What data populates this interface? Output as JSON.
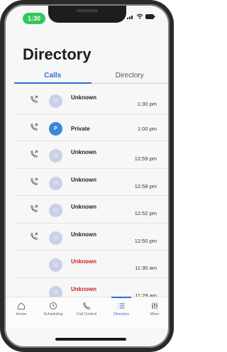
{
  "status_bar": {
    "time": "1:30"
  },
  "header": {
    "title": "Directory"
  },
  "tabs": [
    {
      "label": "Calls",
      "active": true
    },
    {
      "label": "Directory",
      "active": false
    }
  ],
  "calls": [
    {
      "avatar": "U",
      "name": "Unknown",
      "time": "1:30 pm",
      "icon": "outgoing-call-icon",
      "missed": false
    },
    {
      "avatar": "P",
      "name": "Private",
      "time": "1:00 pm",
      "icon": "outgoing-call-icon",
      "missed": false
    },
    {
      "avatar": "U",
      "name": "Unknown",
      "time": "12:59 pm",
      "icon": "outgoing-call-icon",
      "missed": false
    },
    {
      "avatar": "U",
      "name": "Unknown",
      "time": "12:58 pm",
      "icon": "outgoing-call-icon",
      "missed": false
    },
    {
      "avatar": "U",
      "name": "Unknown",
      "time": "12:52 pm",
      "icon": "outgoing-call-icon",
      "missed": false
    },
    {
      "avatar": "U",
      "name": "Unknown",
      "time": "12:50 pm",
      "icon": "outgoing-call-icon",
      "missed": false
    },
    {
      "avatar": "U",
      "name": "Unknown",
      "time": "11:30 am",
      "icon": "",
      "missed": true
    },
    {
      "avatar": "U",
      "name": "Unknown",
      "time": "11:29 am",
      "icon": "",
      "missed": true
    }
  ],
  "tabbar": [
    {
      "label": "Home",
      "icon": "home-icon",
      "active": false
    },
    {
      "label": "Scheduling",
      "icon": "clock-icon",
      "active": false
    },
    {
      "label": "Call Control",
      "icon": "phone-icon",
      "active": false
    },
    {
      "label": "Directory",
      "icon": "list-icon",
      "active": true
    },
    {
      "label": "More",
      "icon": "sliders-icon",
      "active": false
    }
  ],
  "colors": {
    "accent": "#2f6fd0",
    "missed": "#cc1f1f",
    "status_green": "#34c759"
  }
}
